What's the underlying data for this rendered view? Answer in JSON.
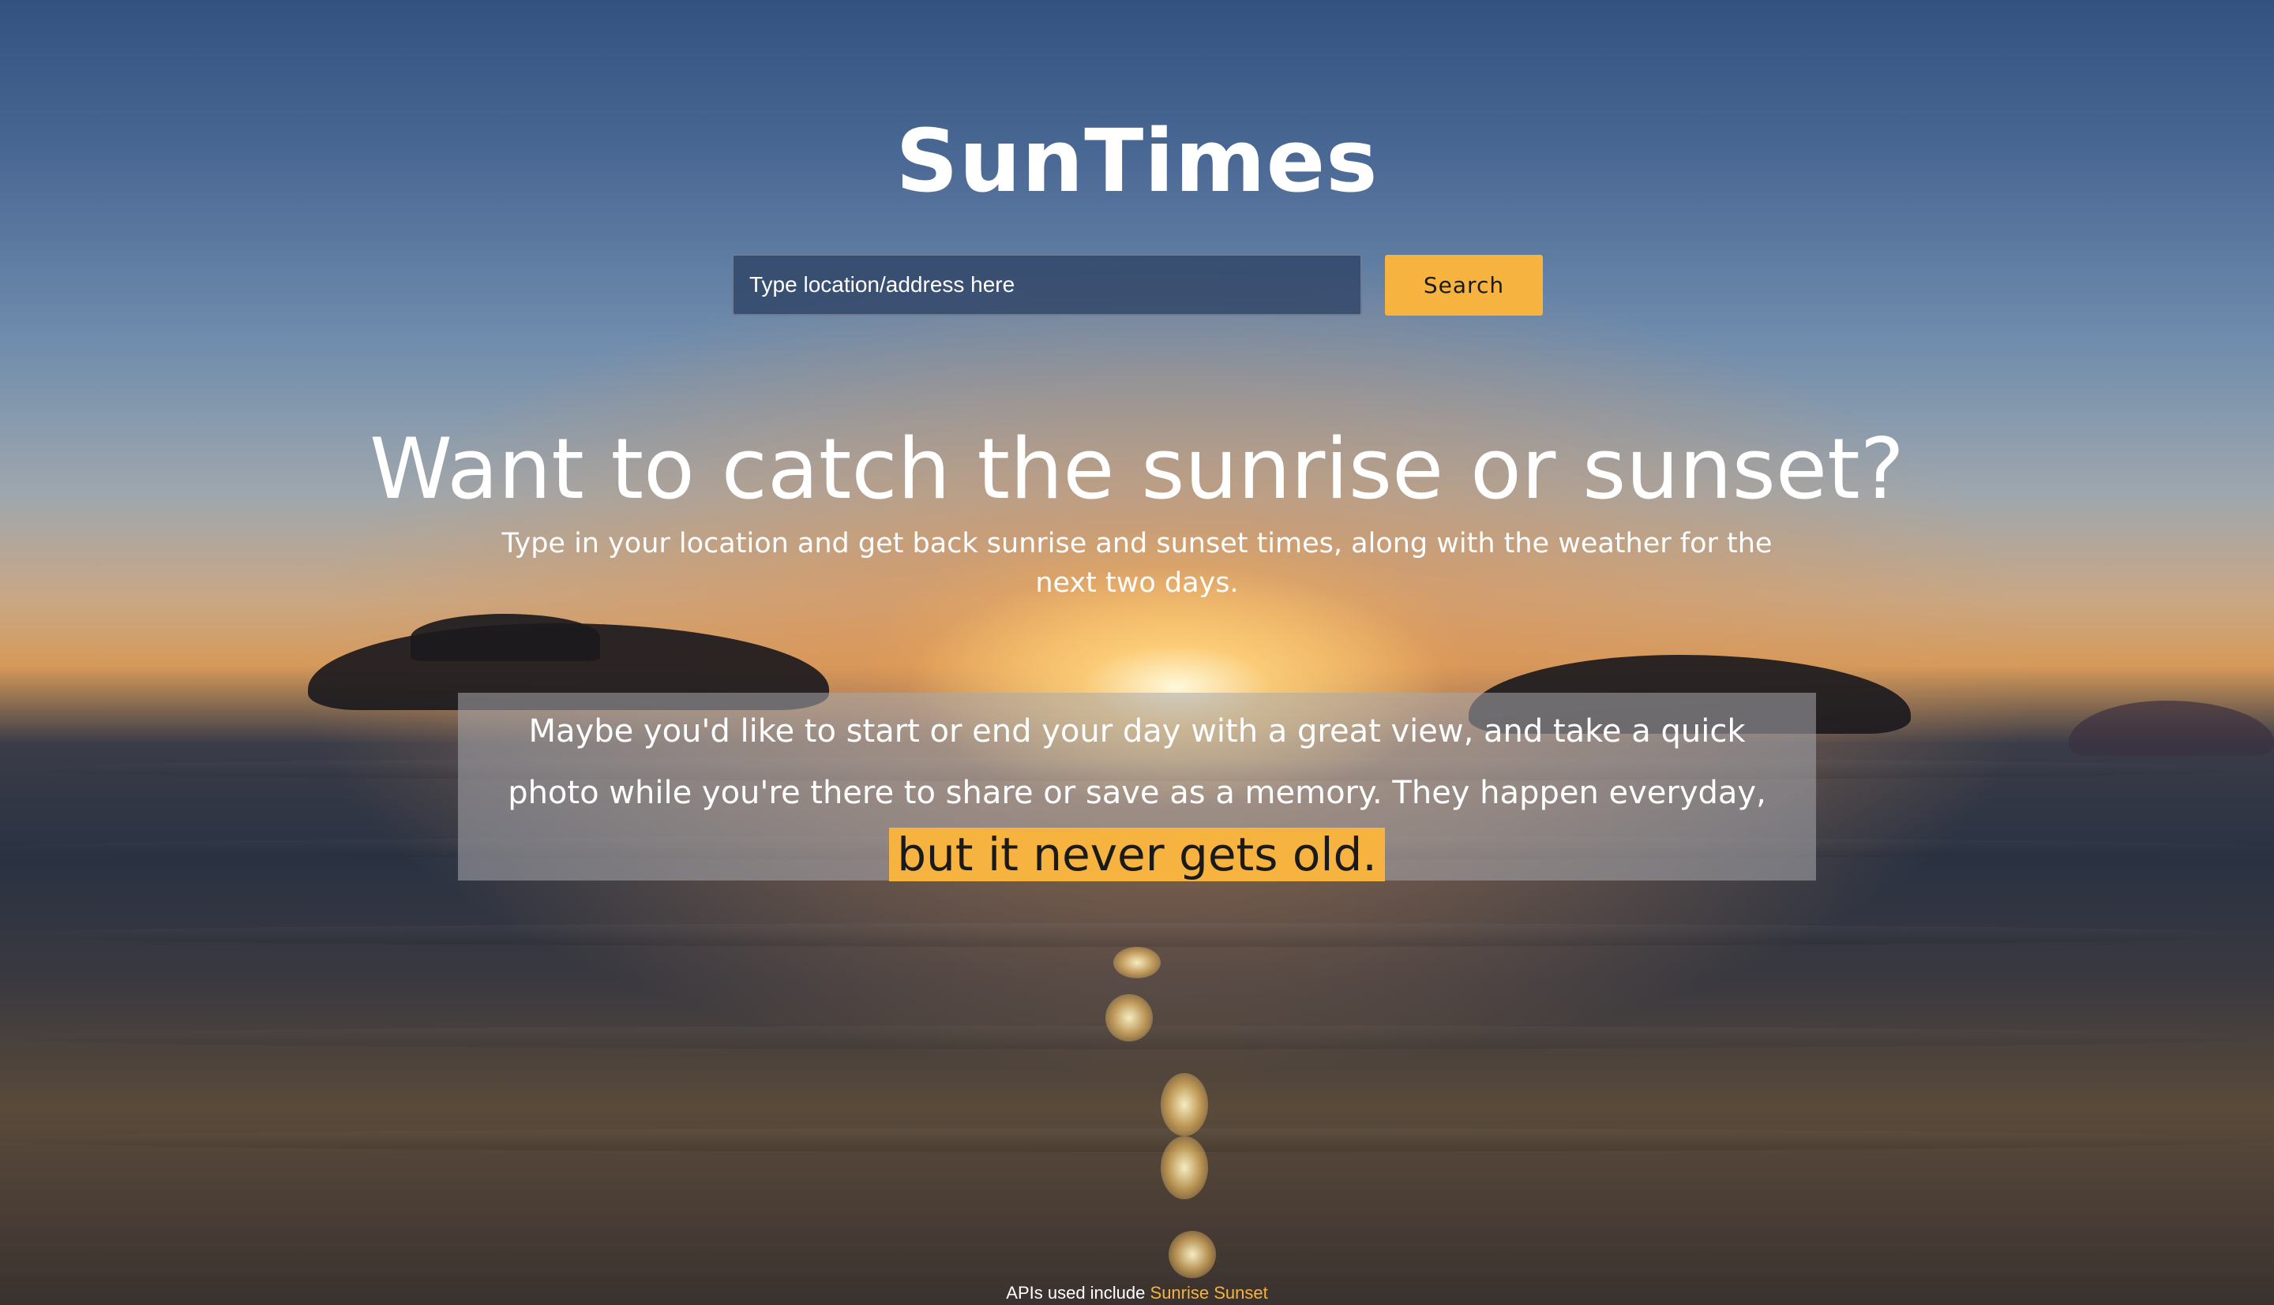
{
  "app": {
    "title": "SunTimes"
  },
  "search": {
    "placeholder": "Type location/address here",
    "value": "",
    "button_label": "Search"
  },
  "hero": {
    "headline": "Want to catch the sunrise or sunset?",
    "subtitle": "Type in your location and get back sunrise and sunset times, along with the weather for the next two days."
  },
  "quote": {
    "text": "Maybe you'd like to start or end your day with a great view, and take a quick photo while you're there to share or save as a memory. They happen everyday,",
    "highlight": "but it never gets old."
  },
  "footer": {
    "prefix": "APIs used include",
    "link_label": "Sunrise Sunset"
  },
  "colors": {
    "accent": "#f6b33f",
    "input_bg": "#2d4164",
    "text": "#ffffff"
  }
}
